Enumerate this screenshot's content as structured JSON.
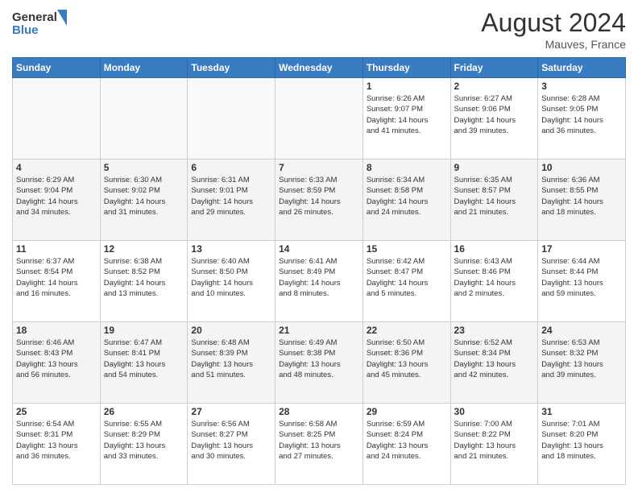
{
  "header": {
    "logo_general": "General",
    "logo_blue": "Blue",
    "month_year": "August 2024",
    "location": "Mauves, France"
  },
  "days_of_week": [
    "Sunday",
    "Monday",
    "Tuesday",
    "Wednesday",
    "Thursday",
    "Friday",
    "Saturday"
  ],
  "weeks": [
    [
      {
        "day": "",
        "info": ""
      },
      {
        "day": "",
        "info": ""
      },
      {
        "day": "",
        "info": ""
      },
      {
        "day": "",
        "info": ""
      },
      {
        "day": "1",
        "info": "Sunrise: 6:26 AM\nSunset: 9:07 PM\nDaylight: 14 hours\nand 41 minutes."
      },
      {
        "day": "2",
        "info": "Sunrise: 6:27 AM\nSunset: 9:06 PM\nDaylight: 14 hours\nand 39 minutes."
      },
      {
        "day": "3",
        "info": "Sunrise: 6:28 AM\nSunset: 9:05 PM\nDaylight: 14 hours\nand 36 minutes."
      }
    ],
    [
      {
        "day": "4",
        "info": "Sunrise: 6:29 AM\nSunset: 9:04 PM\nDaylight: 14 hours\nand 34 minutes."
      },
      {
        "day": "5",
        "info": "Sunrise: 6:30 AM\nSunset: 9:02 PM\nDaylight: 14 hours\nand 31 minutes."
      },
      {
        "day": "6",
        "info": "Sunrise: 6:31 AM\nSunset: 9:01 PM\nDaylight: 14 hours\nand 29 minutes."
      },
      {
        "day": "7",
        "info": "Sunrise: 6:33 AM\nSunset: 8:59 PM\nDaylight: 14 hours\nand 26 minutes."
      },
      {
        "day": "8",
        "info": "Sunrise: 6:34 AM\nSunset: 8:58 PM\nDaylight: 14 hours\nand 24 minutes."
      },
      {
        "day": "9",
        "info": "Sunrise: 6:35 AM\nSunset: 8:57 PM\nDaylight: 14 hours\nand 21 minutes."
      },
      {
        "day": "10",
        "info": "Sunrise: 6:36 AM\nSunset: 8:55 PM\nDaylight: 14 hours\nand 18 minutes."
      }
    ],
    [
      {
        "day": "11",
        "info": "Sunrise: 6:37 AM\nSunset: 8:54 PM\nDaylight: 14 hours\nand 16 minutes."
      },
      {
        "day": "12",
        "info": "Sunrise: 6:38 AM\nSunset: 8:52 PM\nDaylight: 14 hours\nand 13 minutes."
      },
      {
        "day": "13",
        "info": "Sunrise: 6:40 AM\nSunset: 8:50 PM\nDaylight: 14 hours\nand 10 minutes."
      },
      {
        "day": "14",
        "info": "Sunrise: 6:41 AM\nSunset: 8:49 PM\nDaylight: 14 hours\nand 8 minutes."
      },
      {
        "day": "15",
        "info": "Sunrise: 6:42 AM\nSunset: 8:47 PM\nDaylight: 14 hours\nand 5 minutes."
      },
      {
        "day": "16",
        "info": "Sunrise: 6:43 AM\nSunset: 8:46 PM\nDaylight: 14 hours\nand 2 minutes."
      },
      {
        "day": "17",
        "info": "Sunrise: 6:44 AM\nSunset: 8:44 PM\nDaylight: 13 hours\nand 59 minutes."
      }
    ],
    [
      {
        "day": "18",
        "info": "Sunrise: 6:46 AM\nSunset: 8:43 PM\nDaylight: 13 hours\nand 56 minutes."
      },
      {
        "day": "19",
        "info": "Sunrise: 6:47 AM\nSunset: 8:41 PM\nDaylight: 13 hours\nand 54 minutes."
      },
      {
        "day": "20",
        "info": "Sunrise: 6:48 AM\nSunset: 8:39 PM\nDaylight: 13 hours\nand 51 minutes."
      },
      {
        "day": "21",
        "info": "Sunrise: 6:49 AM\nSunset: 8:38 PM\nDaylight: 13 hours\nand 48 minutes."
      },
      {
        "day": "22",
        "info": "Sunrise: 6:50 AM\nSunset: 8:36 PM\nDaylight: 13 hours\nand 45 minutes."
      },
      {
        "day": "23",
        "info": "Sunrise: 6:52 AM\nSunset: 8:34 PM\nDaylight: 13 hours\nand 42 minutes."
      },
      {
        "day": "24",
        "info": "Sunrise: 6:53 AM\nSunset: 8:32 PM\nDaylight: 13 hours\nand 39 minutes."
      }
    ],
    [
      {
        "day": "25",
        "info": "Sunrise: 6:54 AM\nSunset: 8:31 PM\nDaylight: 13 hours\nand 36 minutes."
      },
      {
        "day": "26",
        "info": "Sunrise: 6:55 AM\nSunset: 8:29 PM\nDaylight: 13 hours\nand 33 minutes."
      },
      {
        "day": "27",
        "info": "Sunrise: 6:56 AM\nSunset: 8:27 PM\nDaylight: 13 hours\nand 30 minutes."
      },
      {
        "day": "28",
        "info": "Sunrise: 6:58 AM\nSunset: 8:25 PM\nDaylight: 13 hours\nand 27 minutes."
      },
      {
        "day": "29",
        "info": "Sunrise: 6:59 AM\nSunset: 8:24 PM\nDaylight: 13 hours\nand 24 minutes."
      },
      {
        "day": "30",
        "info": "Sunrise: 7:00 AM\nSunset: 8:22 PM\nDaylight: 13 hours\nand 21 minutes."
      },
      {
        "day": "31",
        "info": "Sunrise: 7:01 AM\nSunset: 8:20 PM\nDaylight: 13 hours\nand 18 minutes."
      }
    ]
  ]
}
